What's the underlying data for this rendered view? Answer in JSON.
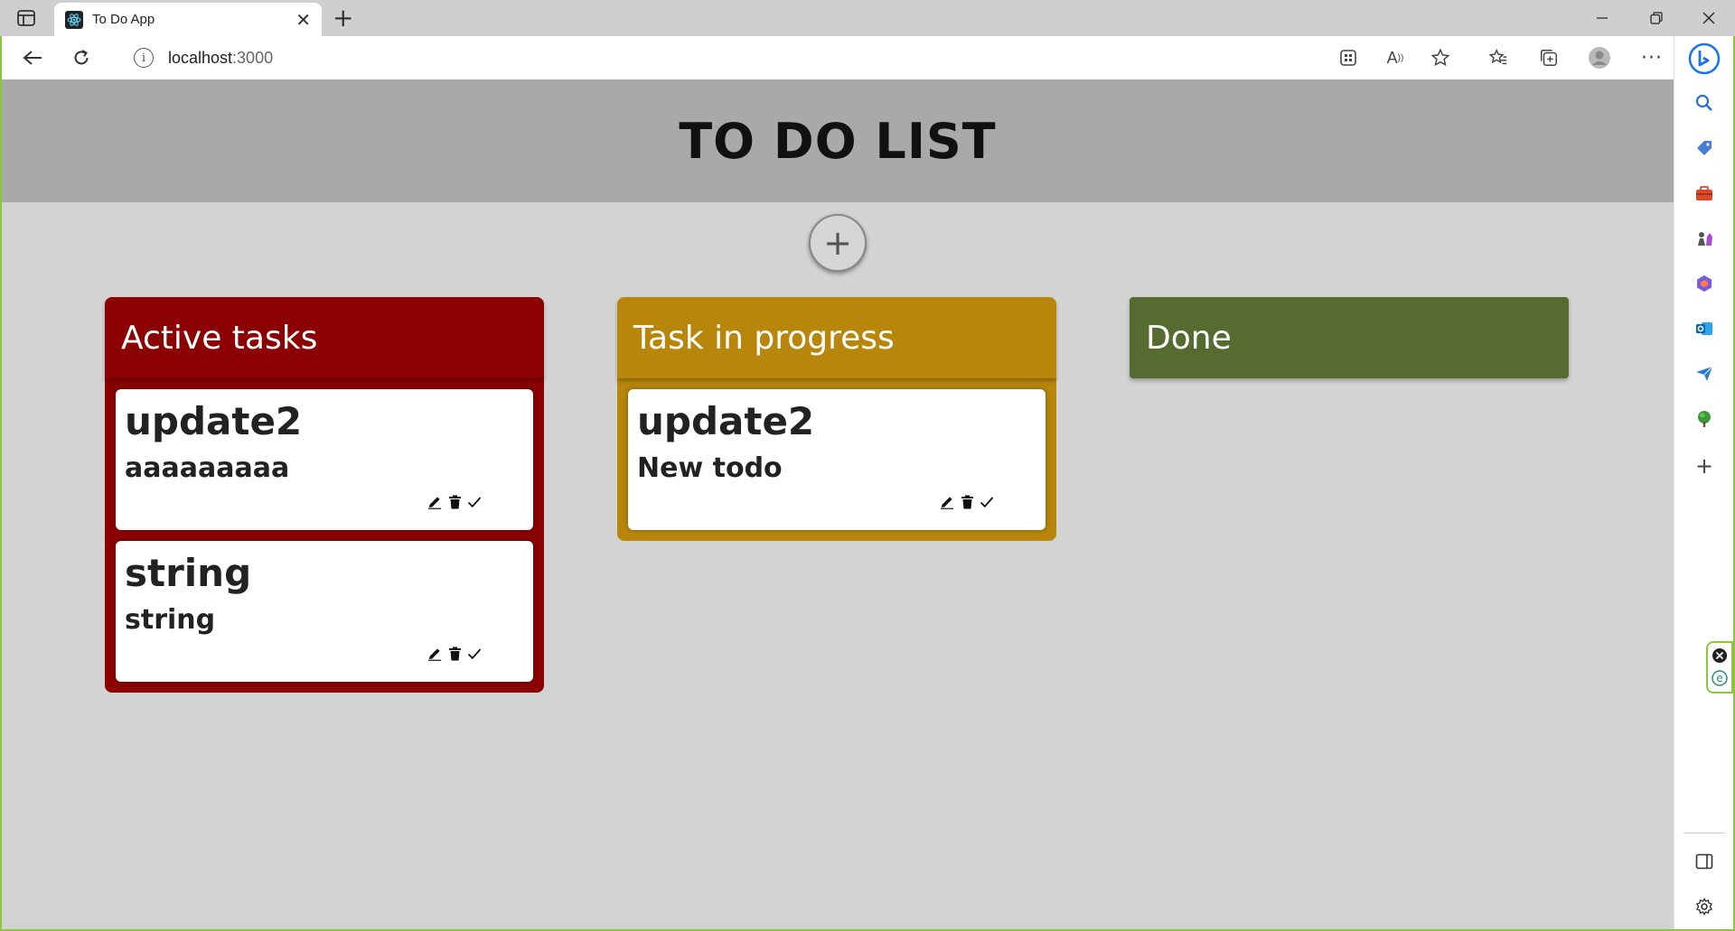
{
  "browser": {
    "tab_title": "To Do App",
    "url_host": "localhost",
    "url_port": ":3000"
  },
  "app": {
    "title": "TO DO LIST",
    "add_button_label": "+"
  },
  "columns": [
    {
      "title": "Active tasks",
      "color": "#8b0000",
      "cards": [
        {
          "title": "update2",
          "description": "aaaaaaaaa"
        },
        {
          "title": "string",
          "description": "string"
        }
      ]
    },
    {
      "title": "Task in progress",
      "color": "#b8860b",
      "cards": [
        {
          "title": "update2",
          "description": "New todo"
        }
      ]
    },
    {
      "title": "Done",
      "color": "#556b2f",
      "cards": []
    }
  ],
  "card_actions": [
    "pencil-icon",
    "trash-icon",
    "checkmark-icon"
  ]
}
